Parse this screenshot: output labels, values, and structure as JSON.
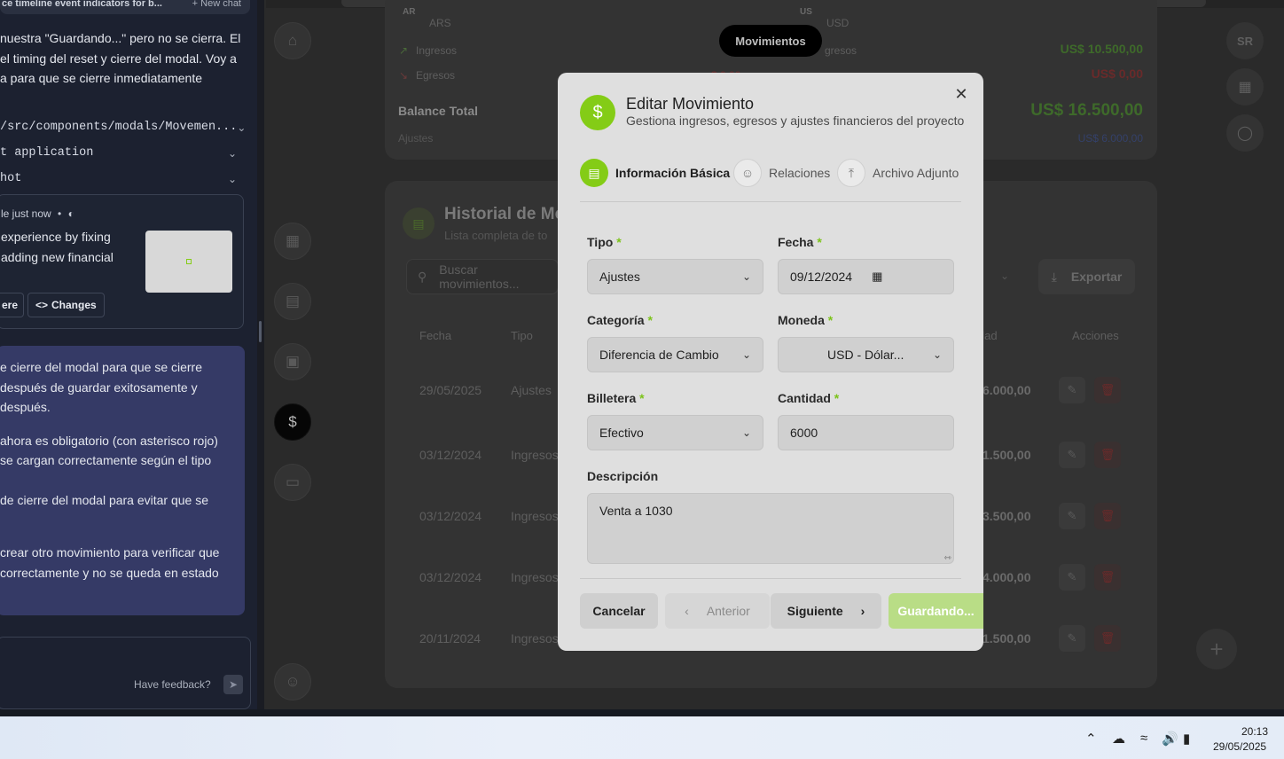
{
  "chat": {
    "top_title": "ce timeline event indicators for b...",
    "new_chat": "+ New chat",
    "msg_lines": [
      "nuestra \"Guardando...\" pero no se cierra. El",
      "el timing del reset y cierre del modal. Voy a",
      "a para que se cierre inmediatamente"
    ],
    "tool_rows": [
      "/src/components/modals/Movemen...",
      "t application",
      "hot"
    ],
    "card_meta": "le just now",
    "card_lines": [
      "experience by fixing",
      "adding new financial"
    ],
    "card_btn_left": "ere",
    "card_btn_changes": "Changes",
    "summary_lines": [
      "e cierre del modal para que se cierre",
      "después de guardar exitosamente y",
      "después.",
      "",
      " ahora es obligatorio (con asterisco rojo)",
      "se cargan correctamente según el tipo",
      "",
      "de cierre del modal para evitar que se",
      "",
      "",
      "crear otro movimiento para verificar que",
      " correctamente y no se queda en estado"
    ],
    "feedback": "Have feedback?"
  },
  "app": {
    "tooltip": "Movimientos",
    "avatar": "SR",
    "top_summary": {
      "col1_code": "AR",
      "col1_currency": "ARS",
      "col2_code": "US",
      "col2_currency": "USD",
      "ingresos": "Ingresos",
      "egresos": "Egresos",
      "ingresos_value": "US$ 10.500,00",
      "egresos_value": "US$ 0,00",
      "balance_label": "Balance Total",
      "balance_value": "US$ 16.500,00",
      "ajustes_label": "Ajustes",
      "ajustes_value": "US$ 6.000,00",
      "egresos_left_value": "$ 0,00"
    },
    "history": {
      "title": "Historial de Mo",
      "subtitle": "Lista completa de to",
      "search_placeholder": "Buscar movimientos...",
      "export": "Exportar",
      "col_fecha": "Fecha",
      "col_tipo": "Tipo",
      "col_cantidad": "idad",
      "col_acciones": "Acciones",
      "rows": [
        {
          "fecha": "29/05/2025",
          "tipo": "Ajustes",
          "cantidad": "6.000,00"
        },
        {
          "fecha": "03/12/2024",
          "tipo": "Ingresos",
          "cantidad": "1.500,00"
        },
        {
          "fecha": "03/12/2024",
          "tipo": "Ingresos",
          "cantidad": "3.500,00"
        },
        {
          "fecha": "03/12/2024",
          "tipo": "Ingresos",
          "cantidad": "4.000,00"
        },
        {
          "fecha": "20/11/2024",
          "tipo": "Ingresos",
          "cantidad": "1.500,00"
        }
      ]
    }
  },
  "modal": {
    "title": "Editar Movimiento",
    "subtitle": "Gestiona ingresos, egresos y ajustes financieros del proyecto",
    "tabs": [
      "Información Básica",
      "Relaciones",
      "Archivo Adjunto"
    ],
    "tipo_label": "Tipo",
    "tipo_value": "Ajustes",
    "fecha_label": "Fecha",
    "fecha_value": "09/12/2024",
    "categoria_label": "Categoría",
    "categoria_value": "Diferencia de Cambio",
    "moneda_label": "Moneda",
    "moneda_value": "USD - Dólar...",
    "billetera_label": "Billetera",
    "billetera_value": "Efectivo",
    "cantidad_label": "Cantidad",
    "cantidad_value": "6000",
    "descripcion_label": "Descripción",
    "descripcion_value": "Venta a 1030",
    "required_mark": "*",
    "cancel": "Cancelar",
    "previous": "Anterior",
    "next": "Siguiente",
    "saving": "Guardando...",
    "accent": "#84cc16"
  },
  "taskbar": {
    "time": "20:13",
    "date": "29/05/2025"
  }
}
